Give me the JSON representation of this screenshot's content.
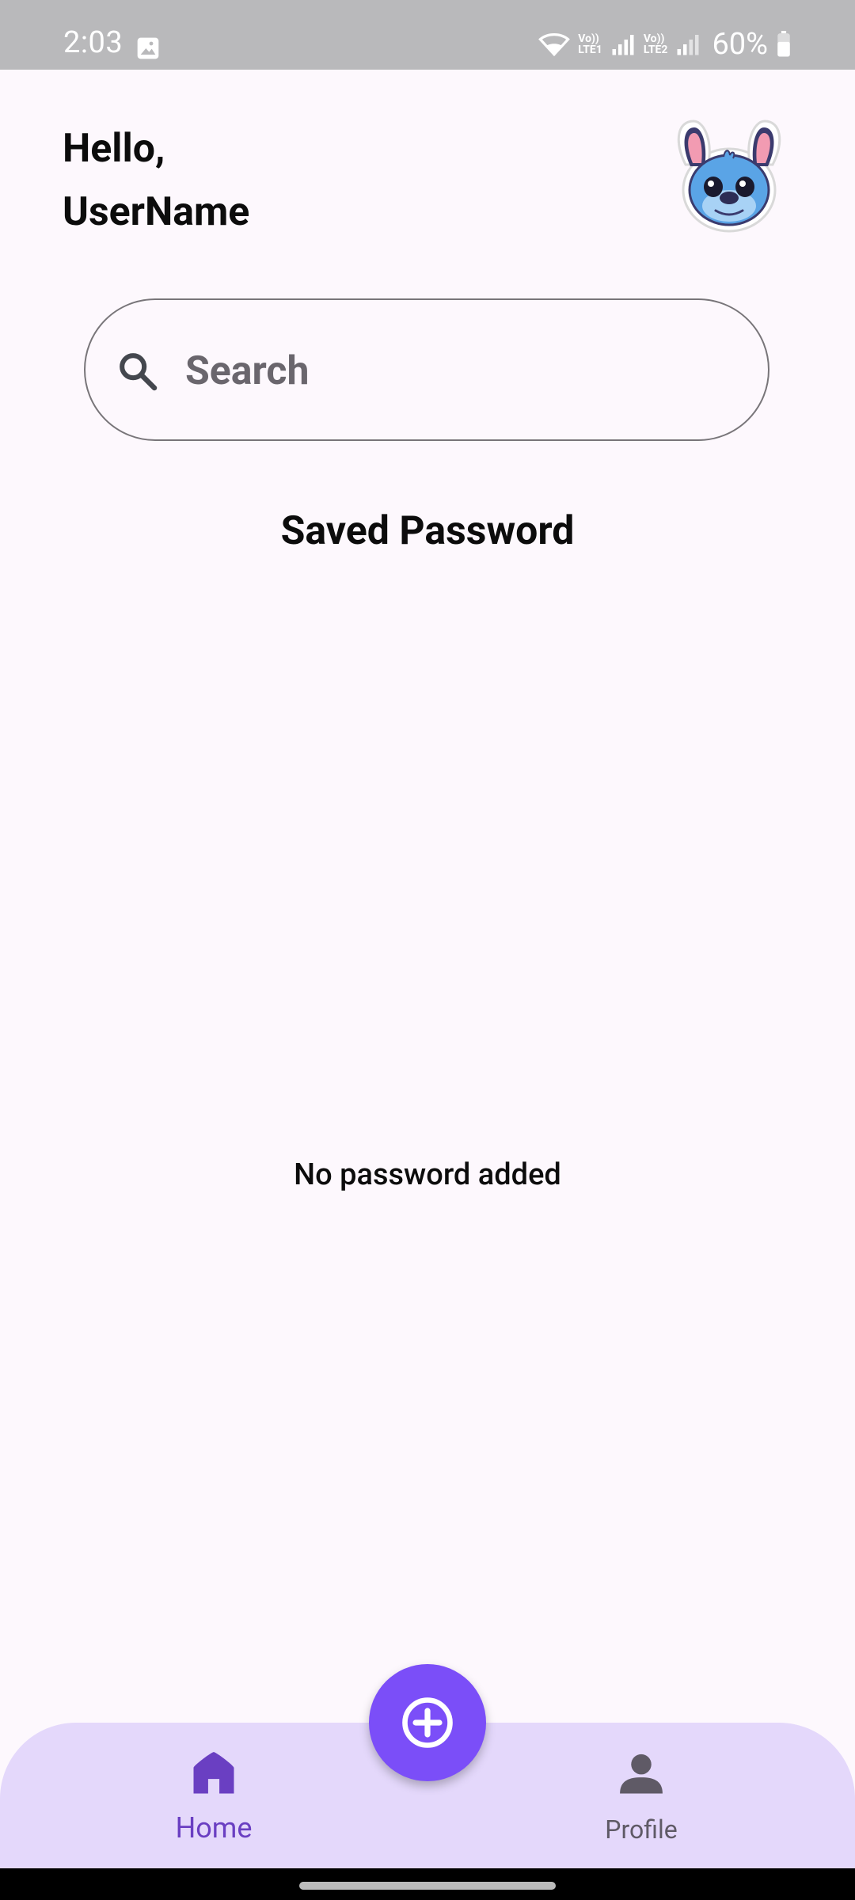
{
  "status_bar": {
    "time": "2:03",
    "net1": [
      "Vo))",
      "LTE1"
    ],
    "net2": [
      "Vo))",
      "LTE2"
    ],
    "battery": "60%"
  },
  "header": {
    "greeting_line1": "Hello,",
    "greeting_line2": "UserName",
    "avatar_icon": "cartoon-avatar-icon"
  },
  "search": {
    "placeholder": "Search",
    "value": ""
  },
  "main": {
    "section_title": "Saved Password",
    "empty_message": "No password added"
  },
  "fab": {
    "icon": "add-circle-icon"
  },
  "bottom_nav": {
    "items": [
      {
        "label": "Home",
        "icon": "home-icon",
        "active": true
      },
      {
        "label": "Profile",
        "icon": "person-icon",
        "active": false
      }
    ]
  },
  "colors": {
    "background": "#fdf8fd",
    "accent": "#7b4ef8",
    "nav_bg": "#e4d8fb",
    "active_nav": "#6a3fc2"
  }
}
